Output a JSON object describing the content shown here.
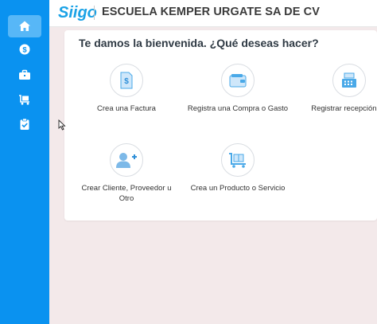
{
  "app": {
    "logo_text": "Siigo",
    "company_name": "ESCUELA KEMPER URGATE SA DE CV"
  },
  "sidebar": {
    "items": [
      {
        "icon": "home-icon",
        "active": true
      },
      {
        "icon": "dollar-icon",
        "active": false
      },
      {
        "icon": "briefcase-icon",
        "active": false
      },
      {
        "icon": "cart-icon",
        "active": false
      },
      {
        "icon": "clipboard-check-icon",
        "active": false
      }
    ]
  },
  "welcome": {
    "title": "Te damos la bienvenida. ¿Qué deseas hacer?",
    "actions": [
      {
        "label": "Crea una Factura",
        "icon": "invoice-icon"
      },
      {
        "label": "Registra una Compra o Gasto",
        "icon": "wallet-icon"
      },
      {
        "label": "Registrar recepción de",
        "icon": "cash-register-icon"
      },
      {
        "label": "Crear Cliente, Proveedor u Otro",
        "icon": "add-user-icon"
      },
      {
        "label": "Crea un Producto o Servicio",
        "icon": "product-cart-icon"
      }
    ]
  },
  "colors": {
    "sidebar": "#0a92f0",
    "sidebar_active": "#57b7f7",
    "brand": "#1aa2e6",
    "background": "#f3e9ea",
    "icon_accent": "#4aa9e8"
  }
}
